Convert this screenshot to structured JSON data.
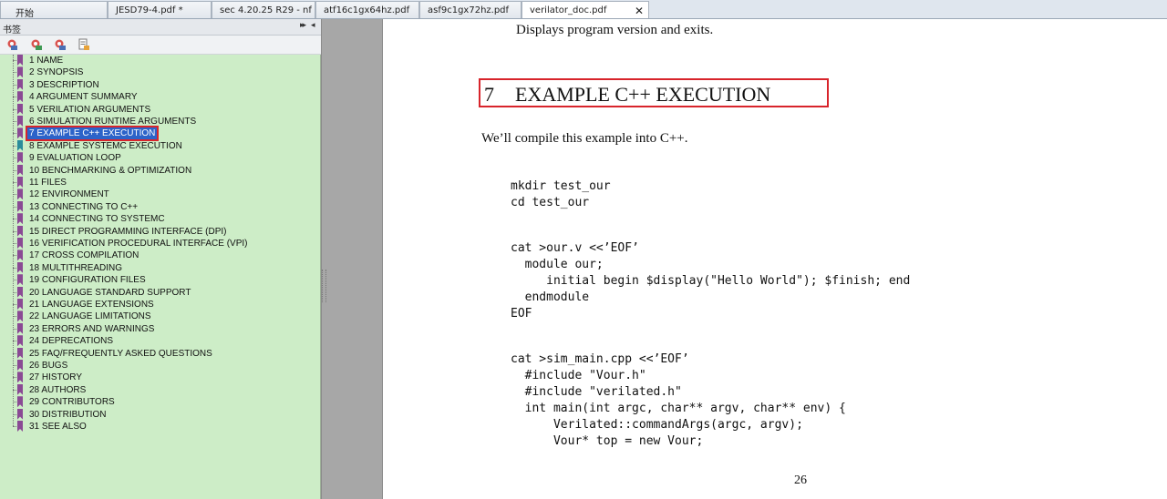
{
  "tabs": [
    {
      "label": "开始"
    },
    {
      "label": "JESD79-4.pdf *"
    },
    {
      "label": "sec 4.20.25 R29 - nf ..."
    },
    {
      "label": "atf16c1gx64hz.pdf"
    },
    {
      "label": "asf9c1gx72hz.pdf"
    },
    {
      "label": "verilator_doc.pdf",
      "close": "✕"
    }
  ],
  "sidebar": {
    "title": "书签",
    "pin_glyph": "▸▸",
    "close_glyph": "◂",
    "toolbar_icons": [
      "bookmark-add-icon",
      "bookmark-expand-icon",
      "bookmark-collapse-icon",
      "bookmark-properties-icon"
    ],
    "bookmarks": [
      "1 NAME",
      "2 SYNOPSIS",
      "3 DESCRIPTION",
      "4 ARGUMENT SUMMARY",
      "5 VERILATION ARGUMENTS",
      "6 SIMULATION RUNTIME ARGUMENTS",
      "7 EXAMPLE C++ EXECUTION",
      "8 EXAMPLE SYSTEMC EXECUTION",
      "9 EVALUATION LOOP",
      "10 BENCHMARKING & OPTIMIZATION",
      "11 FILES",
      "12 ENVIRONMENT",
      "13 CONNECTING TO C++",
      "14 CONNECTING TO SYSTEMC",
      "15 DIRECT PROGRAMMING INTERFACE (DPI)",
      "16 VERIFICATION PROCEDURAL INTERFACE (VPI)",
      "17 CROSS COMPILATION",
      "18 MULTITHREADING",
      "19 CONFIGURATION FILES",
      "20 LANGUAGE STANDARD SUPPORT",
      "21 LANGUAGE EXTENSIONS",
      "22 LANGUAGE LIMITATIONS",
      "23 ERRORS AND WARNINGS",
      "24 DEPRECATIONS",
      "25 FAQ/FREQUENTLY ASKED QUESTIONS",
      "26 BUGS",
      "27 HISTORY",
      "28 AUTHORS",
      "29 CONTRIBUTORS",
      "30 DISTRIBUTION",
      "31 SEE ALSO"
    ],
    "selected_index": 6,
    "teal_index": 7
  },
  "document": {
    "top_line": "Displays program version and exits.",
    "section_number": "7",
    "section_title": "EXAMPLE C++ EXECUTION",
    "intro": "We’ll compile this example into C++.",
    "code_lines": [
      "mkdir test_our",
      "cd test_our",
      "cat >our.v <<’EOF’",
      "  module our;",
      "     initial begin $display(\"Hello World\"); $finish; end",
      "  endmodule",
      "EOF",
      "cat >sim_main.cpp <<’EOF’",
      "  #include \"Vour.h\"",
      "  #include \"verilated.h\"",
      "  int main(int argc, char** argv, char** env) {",
      "      Verilated::commandArgs(argc, argv);",
      "      Vour* top = new Vour;"
    ],
    "page_number": "26"
  },
  "colors": {
    "sidebar_bg": "#cdedc7",
    "selection_bg": "#2c63c9",
    "highlight_border": "#d8242b",
    "bookmark_flag": "#8a4a94",
    "bookmark_flag_teal": "#2a8c9a"
  }
}
